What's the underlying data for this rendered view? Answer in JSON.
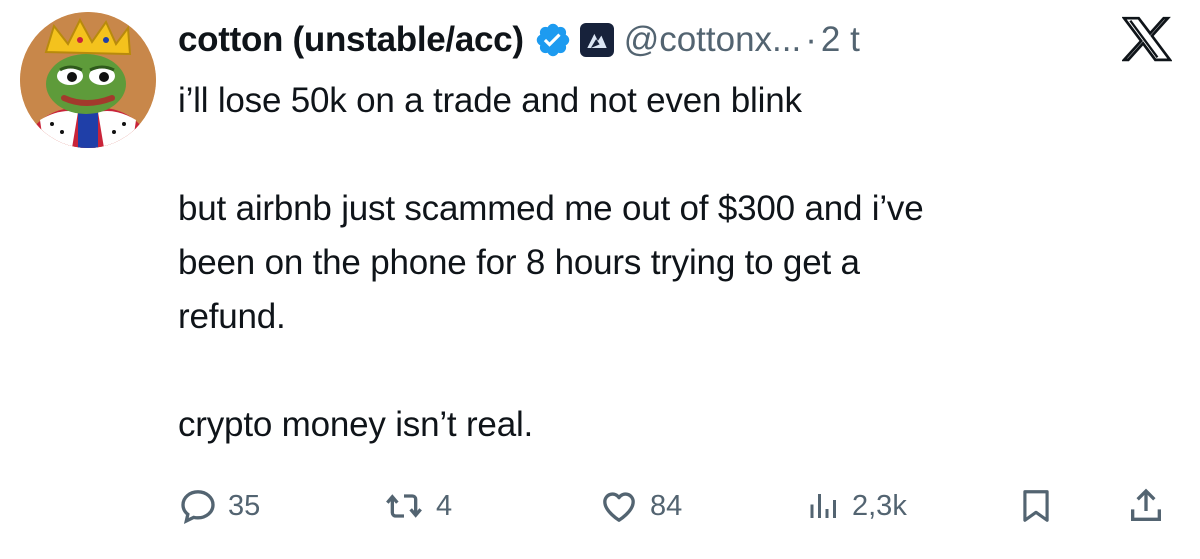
{
  "tweet": {
    "display_name": "cotton (unstable/acc)",
    "handle": "@cottonx...",
    "separator": "·",
    "time": "2 t",
    "paragraphs": [
      "i’ll lose 50k on a trade and not even blink",
      "but airbnb just scammed me out of $300 and i’ve\nbeen on the phone for 8 hours trying to get a\nrefund.",
      "crypto money isn’t real."
    ]
  },
  "actions": {
    "replies": "35",
    "reposts": "4",
    "likes": "84",
    "views": "2,3k"
  },
  "icons": {
    "verified": "verified-badge-icon",
    "affiliate": "affiliate-logo-icon",
    "x_logo": "x-logo-icon",
    "reply": "reply-icon",
    "repost": "repost-icon",
    "like": "heart-icon",
    "views": "views-icon",
    "bookmark": "bookmark-icon",
    "share": "share-icon"
  },
  "colors": {
    "text": "#0f1419",
    "secondary": "#536471",
    "verified_blue": "#1d9bf0",
    "affiliate_bg": "#17223b"
  }
}
